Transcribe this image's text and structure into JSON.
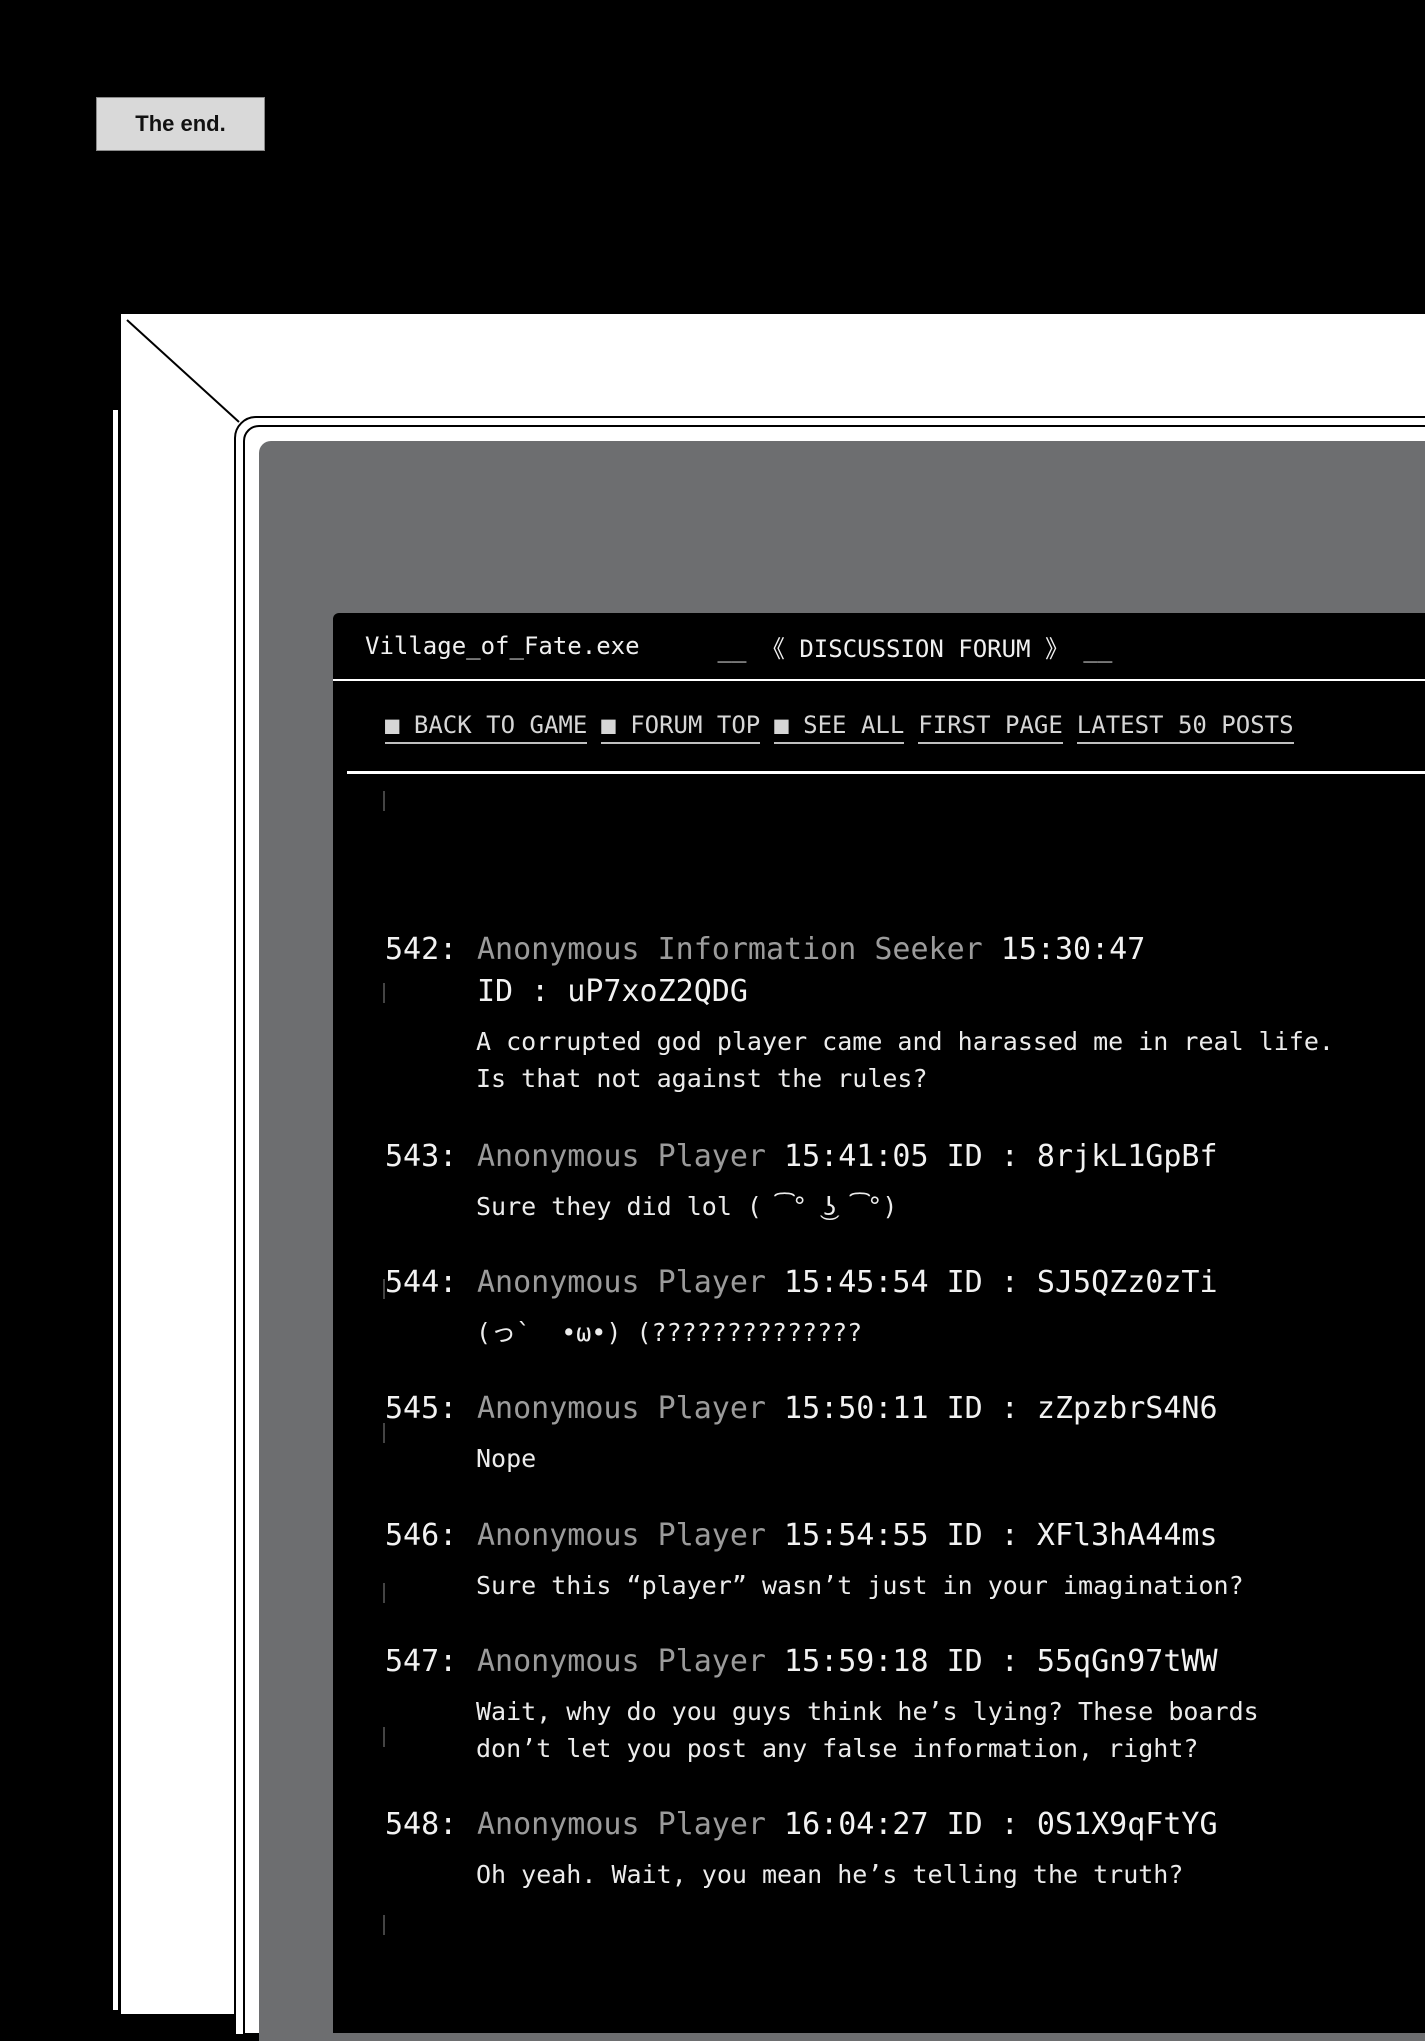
{
  "caption": "The end.",
  "window": {
    "app_name": "Village_of_Fate.exe",
    "forum_title": "__ 《 DISCUSSION FORUM 》 __"
  },
  "nav": [
    {
      "label": "■ BACK TO GAME"
    },
    {
      "label": "■ FORUM TOP"
    },
    {
      "label": "■ SEE ALL"
    },
    {
      "label": "FIRST PAGE"
    },
    {
      "label": "LATEST 50 POSTS"
    }
  ],
  "posts": [
    {
      "num": "542:",
      "name": "Anonymous Information Seeker",
      "time": "15:30:47",
      "id": "ID : uP7xoZ2QDG",
      "body": "A corrupted god player came and harassed me in real life.\nIs that not against the rules?"
    },
    {
      "num": "543:",
      "name": "Anonymous Player",
      "time": "15:41:05",
      "id": "ID : 8rjkL1GpBf",
      "body": "Sure they did lol ( ͡° ͜ʖ ͡°)"
    },
    {
      "num": "544:",
      "name": "Anonymous Player",
      "time": "15:45:54",
      "id": "ID : SJ5QZz0zTi",
      "body": "(っ`  •ω•) (??????????????"
    },
    {
      "num": "545:",
      "name": "Anonymous Player",
      "time": "15:50:11",
      "id": "ID : zZpzbrS4N6",
      "body": "Nope"
    },
    {
      "num": "546:",
      "name": "Anonymous Player",
      "time": "15:54:55",
      "id": "ID : XFl3hA44ms",
      "body": "Sure this “player” wasn’t just in your imagination?"
    },
    {
      "num": "547:",
      "name": "Anonymous Player",
      "time": "15:59:18",
      "id": "ID : 55qGn97tWW",
      "body": "Wait, why do you guys think he’s lying? These boards\ndon’t let you post any false information, right?"
    },
    {
      "num": "548:",
      "name": "Anonymous Player",
      "time": "16:04:27",
      "id": "ID : 0S1X9qFtYG",
      "body": "Oh yeah. Wait, you mean he’s telling the truth?"
    }
  ]
}
